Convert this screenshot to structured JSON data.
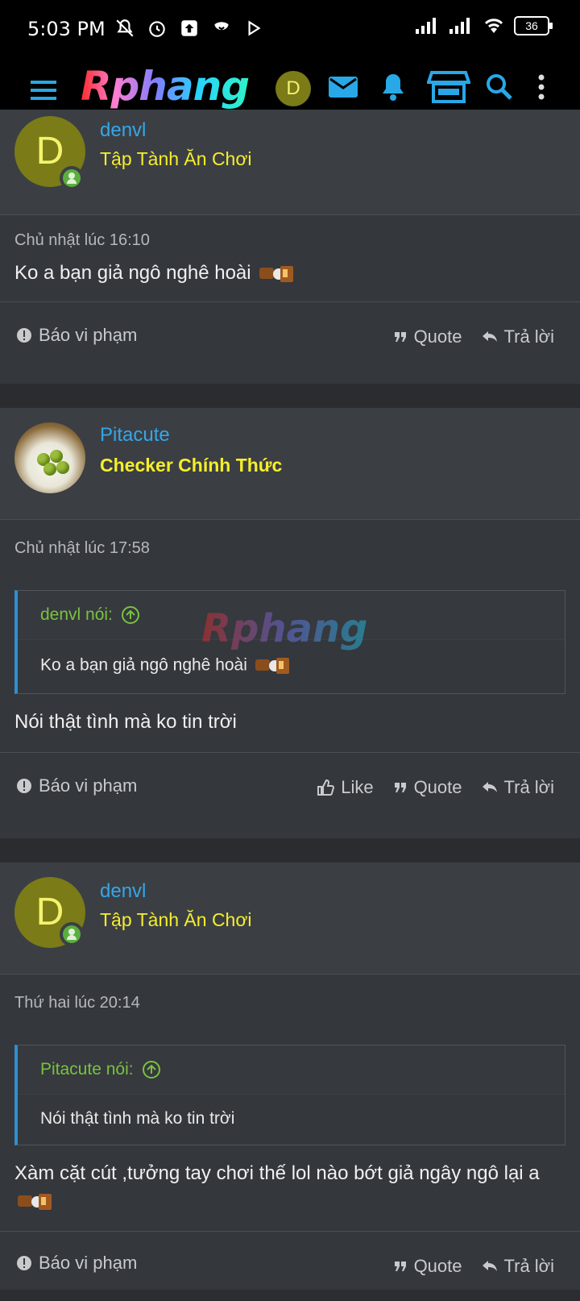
{
  "status_bar": {
    "time": "5:03 PM",
    "battery": "36"
  },
  "nav": {
    "logo": "Rphang",
    "user_initial": "D",
    "accent": "#28a8e6"
  },
  "watermark": "Rphang",
  "posts": [
    {
      "avatar_initial": "D",
      "username": "denvl",
      "user_title": "Tập Tành Ăn Chơi",
      "date": "Chủ nhật lúc 16:10",
      "body": "Ko a bạn giả ngô nghê hoài",
      "report": "Báo vi phạm",
      "quote_action": "Quote",
      "reply_action": "Trả lời"
    },
    {
      "username": "Pitacute",
      "user_title": "Checker Chính Thức",
      "date": "Chủ nhật lúc 17:58",
      "quote_author": "denvl nói:",
      "quote_text": "Ko a bạn giả ngô nghê hoài",
      "body": "Nói thật tình mà ko tin trời",
      "report": "Báo vi phạm",
      "like_action": "Like",
      "quote_action": "Quote",
      "reply_action": "Trả lời"
    },
    {
      "avatar_initial": "D",
      "username": "denvl",
      "user_title": "Tập Tành Ăn Chơi",
      "date": "Thứ hai lúc 20:14",
      "quote_author": "Pitacute nói:",
      "quote_text": "Nói thật tình mà ko tin trời",
      "body": "Xàm cặt cút ,tưởng tay chơi thế lol nào bớt giả ngây ngô lại a",
      "report": "Báo vi phạm",
      "quote_action": "Quote",
      "reply_action": "Trả lời"
    }
  ]
}
